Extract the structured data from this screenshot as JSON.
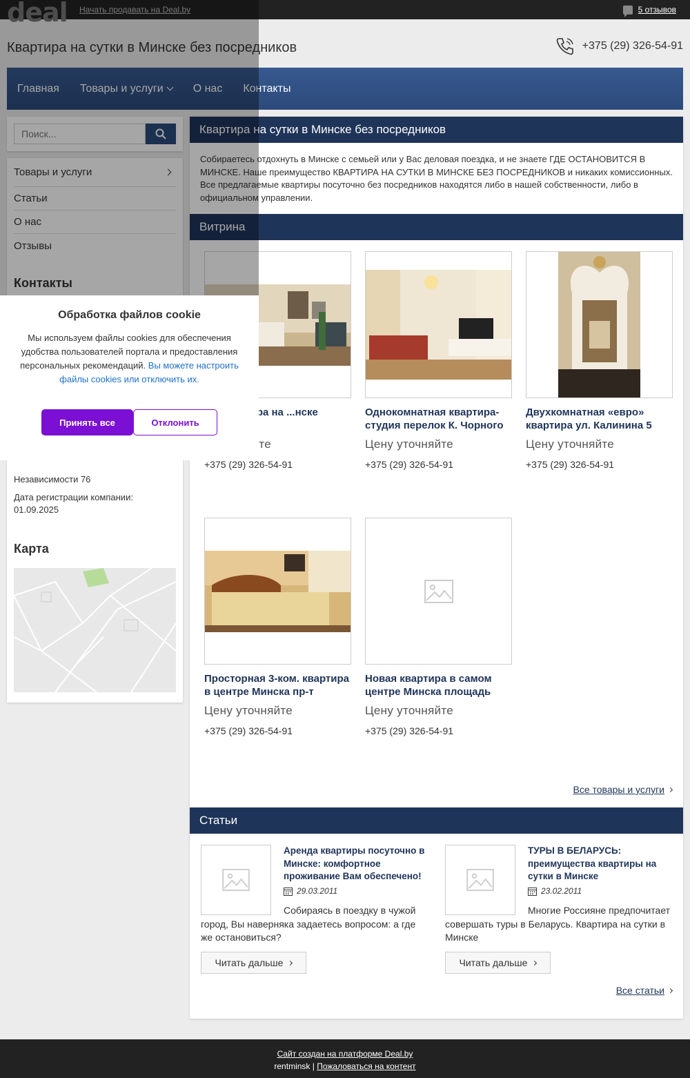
{
  "topbar": {
    "logo": "deal",
    "sell_link": "Начать продавать на Deal.by",
    "reviews": "5 отзывов"
  },
  "header": {
    "title": "Квартира на сутки в Минске без посредников",
    "phone": "+375 (29) 326-54-91"
  },
  "nav": {
    "items": [
      "Главная",
      "Товары и услуги",
      "О нас",
      "Контакты"
    ]
  },
  "search": {
    "placeholder": "Поиск..."
  },
  "sidebar": {
    "menu": [
      "Товары и услуги",
      "Статьи",
      "О нас",
      "Отзывы"
    ],
    "contacts_heading": "Контакты",
    "address": "Независимости 76",
    "reg_label": "Дата регистрации компании:",
    "reg_date": "01.09.2025",
    "map_heading": "Карта"
  },
  "main": {
    "title": "Квартира на сутки в Минске без посредников",
    "intro": "Собираетесь отдохнуть в Минске с семьей или у Вас деловая поездка, и не знаете ГДЕ ОСТАНОВИТСЯ В МИНСКЕ. Наше преимущество КВАРТИРА НА СУТКИ В МИНСКЕ БЕЗ ПОСРЕДНИКОВ и никаких комиссионных. Все предлагаемые квартиры посуточно без посредников находятся либо в нашей собственности, либо в официальном управлении.",
    "showcase_title": "Витрина",
    "products": [
      {
        "name": "...я квартира на ...нске",
        "price": "...уточняйте",
        "phone": "+375 (29) 326-54-91"
      },
      {
        "name": "Однокомнатная квартира-студия перелок К. Чорного 11",
        "price": "Цену уточняйте",
        "phone": "+375 (29) 326-54-91"
      },
      {
        "name": "Двухкомнатная «евро» квартира ул. Калинина 5",
        "price": "Цену уточняйте",
        "phone": "+375 (29) 326-54-91"
      },
      {
        "name": "Просторная 3-ком. квартира в центре Минска пр-т",
        "price": "Цену уточняйте",
        "phone": "+375 (29) 326-54-91"
      },
      {
        "name": "Новая квартира в самом центре Минска площадь",
        "price": "Цену уточняйте",
        "phone": "+375 (29) 326-54-91"
      }
    ],
    "all_products": "Все товары и услуги",
    "articles_title": "Статьи",
    "articles": [
      {
        "title": "Аренда квартиры посуточно в Минске: комфортное проживание Вам обеспечено!",
        "date": "29.03.2011",
        "text": "Собираясь в поездку в чужой город, Вы наверняка задаетесь вопросом: а где же остановиться?",
        "read_more": "Читать дальше"
      },
      {
        "title": "ТУРЫ В БЕЛАРУСЬ: преимущества квартиры на сутки в Минске",
        "date": "23.02.2011",
        "text": "Многие Россияне предпочитает совершать туры в Беларусь. Квартира на сутки в Минске",
        "read_more": "Читать дальше"
      }
    ],
    "all_articles": "Все статьи"
  },
  "footer": {
    "platform": "Сайт создан на платформе Deal.by",
    "site": "rentminsk",
    "separator": "|",
    "complaint": "Пожаловаться на контент"
  },
  "cookie": {
    "title": "Обработка файлов cookie",
    "body": "Мы используем файлы cookies для обеспечения удобства пользователей портала и предоставления персональных рекомендаций.",
    "link": "Вы можете настроить файлы cookies или отключить их.",
    "accept": "Принять все",
    "decline": "Отклонить"
  },
  "colors": {
    "nav_bg": "#2c4a7b",
    "section_bar": "#1f3459",
    "accent_purple": "#7b0fd4",
    "link_blue": "#1e70c8"
  }
}
